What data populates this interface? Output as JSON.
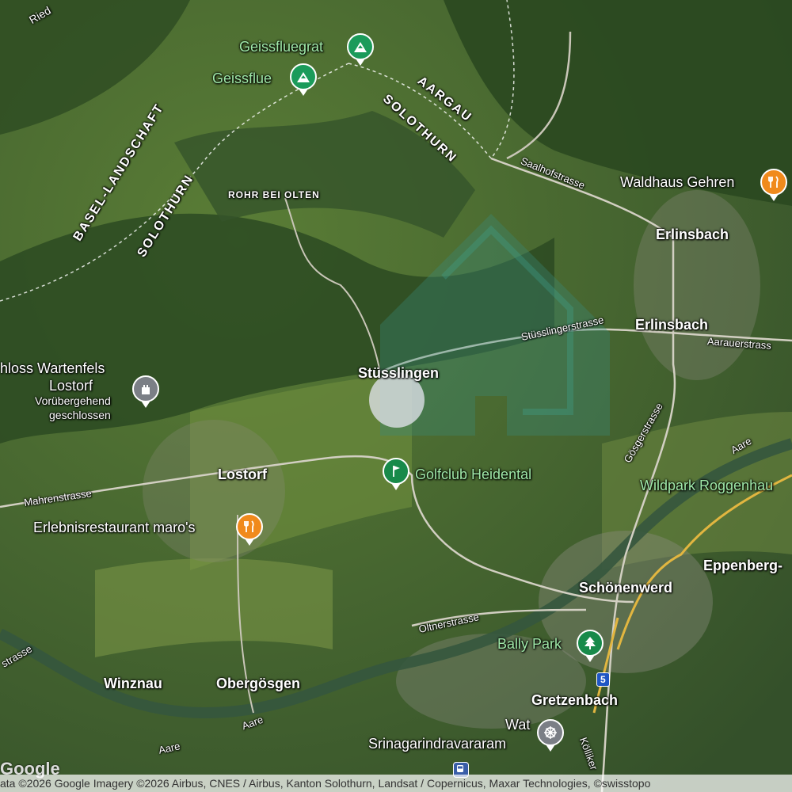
{
  "map": {
    "towns": {
      "stusslingen": "Stüsslingen",
      "lostorf": "Lostorf",
      "erlinsbach_top": "Erlinsbach",
      "erlinsbach_mid": "Erlinsbach",
      "schonenwerd": "Schönenwerd",
      "winznau": "Winznau",
      "obergosgen": "Obergösgen",
      "gretzenbach": "Gretzenbach",
      "eppenberg": "Eppenberg-",
      "rohr": "ROHR BEI OLTEN",
      "ried": "Ried"
    },
    "regions": {
      "aargau": "AARGAU",
      "solothurn_a": "SOLOTHURN",
      "basel_landschaft": "BASEL-LANDSCHAFT",
      "solothurn_b": "SOLOTHURN"
    },
    "pois": {
      "geissfluegrat": "Geissfluegrat",
      "geissflue": "Geissflue",
      "waldhaus": "Waldhaus Gehren",
      "schloss_name": "hloss Wartenfels",
      "schloss_town": "Lostorf",
      "schloss_status_1": "Vorübergehend",
      "schloss_status_2": "geschlossen",
      "golf": "Golfclub Heidental",
      "wildpark": "Wildpark Roggenhau",
      "restaurant": "Erlebnisrestaurant maro's",
      "bally": "Bally Park",
      "wat_1": "Wat",
      "wat_2": "Srinagarindravararam"
    },
    "roads": {
      "saalhof": "Saalhofstrasse",
      "stusslinger": "Stüsslingerstrasse",
      "aarauer": "Aarauerstrass",
      "gosger": "Gösgerstrasse",
      "mahren": "Mahrenstrasse",
      "oltner": "Oltnerstrasse",
      "strasse_left": "strasse",
      "aare_1": "Aare",
      "aare_2": "Aare",
      "aare_3": "Aare",
      "kolliken": "Kölliker"
    },
    "shields": {
      "route5": "5"
    },
    "icons": {
      "mountain": "mountain-icon",
      "restaurant": "restaurant-icon",
      "castle": "castle-icon",
      "golf": "golf-icon",
      "tree": "tree-icon",
      "temple": "temple-icon",
      "transit": "transit-icon"
    },
    "colors": {
      "park_pin": "#1b9b5a",
      "food_pin": "#f08a1c",
      "landmark_pin": "#7b7f86",
      "highway_shield": "#1f56c4",
      "park_label": "#9fe8a8"
    }
  },
  "footer": {
    "attribution": "ata ©2026 Google Imagery ©2026 Airbus, CNES / Airbus, Kanton Solothurn, Landsat / Copernicus, Maxar Technologies, ©swisstopo",
    "logo": "Google"
  }
}
